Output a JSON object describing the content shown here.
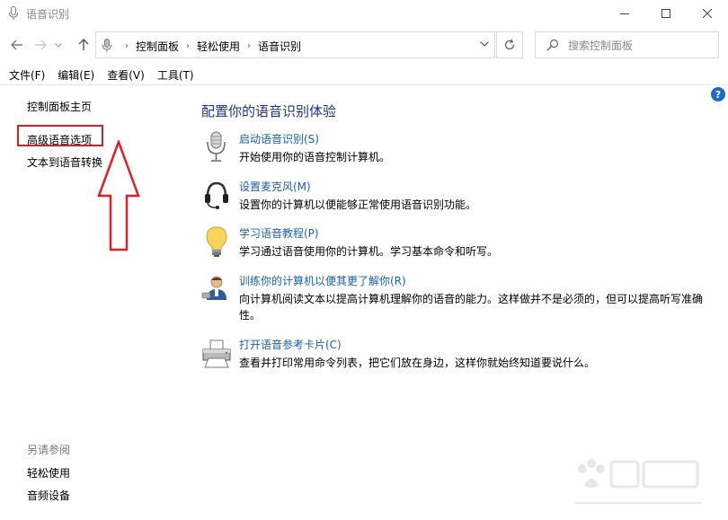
{
  "window": {
    "title": "语音识别",
    "minimize_icon": "minimize-icon",
    "maximize_icon": "maximize-icon",
    "close_icon": "close-icon"
  },
  "nav": {
    "back_icon": "arrow-left-icon",
    "forward_icon": "arrow-right-icon",
    "up_icon": "arrow-up-icon",
    "refresh_icon": "refresh-icon",
    "breadcrumb": [
      "控制面板",
      "轻松使用",
      "语音识别"
    ],
    "search_placeholder": "搜索控制面板"
  },
  "menu": {
    "items": [
      "文件(F)",
      "编辑(E)",
      "查看(V)",
      "工具(T)"
    ]
  },
  "leftnav": {
    "home": "控制面板主页",
    "advanced": "高级语音选项",
    "tts": "文本到语音转换",
    "see_also": "另请参阅",
    "ease": "轻松使用",
    "audio": "音频设备"
  },
  "main": {
    "title": "配置你的语音识别体验",
    "tasks": [
      {
        "link": "启动语音识别(S)",
        "desc": "开始使用你的语音控制计算机。",
        "icon": "microphone-icon"
      },
      {
        "link": "设置麦克风(M)",
        "desc": "设置你的计算机以便能够正常使用语音识别功能。",
        "icon": "headset-icon"
      },
      {
        "link": "学习语音教程(P)",
        "desc": "学习通过语音使用你的计算机。学习基本命令和听写。",
        "icon": "lightbulb-icon"
      },
      {
        "link": "训练你的计算机以便其更了解你(R)",
        "desc": "向计算机阅读文本以提高计算机理解你的语音的能力。这样做并不是必须的，但可以提高听写准确性。",
        "icon": "user-train-icon"
      },
      {
        "link": "打开语音参考卡片(C)",
        "desc": "查看并打印常用命令列表，把它们放在身边，这样你就始终知道要说什么。",
        "icon": "printer-icon"
      }
    ]
  },
  "colors": {
    "link": "#1a5fb4",
    "title": "#1e3287",
    "highlight": "#e01d22"
  }
}
